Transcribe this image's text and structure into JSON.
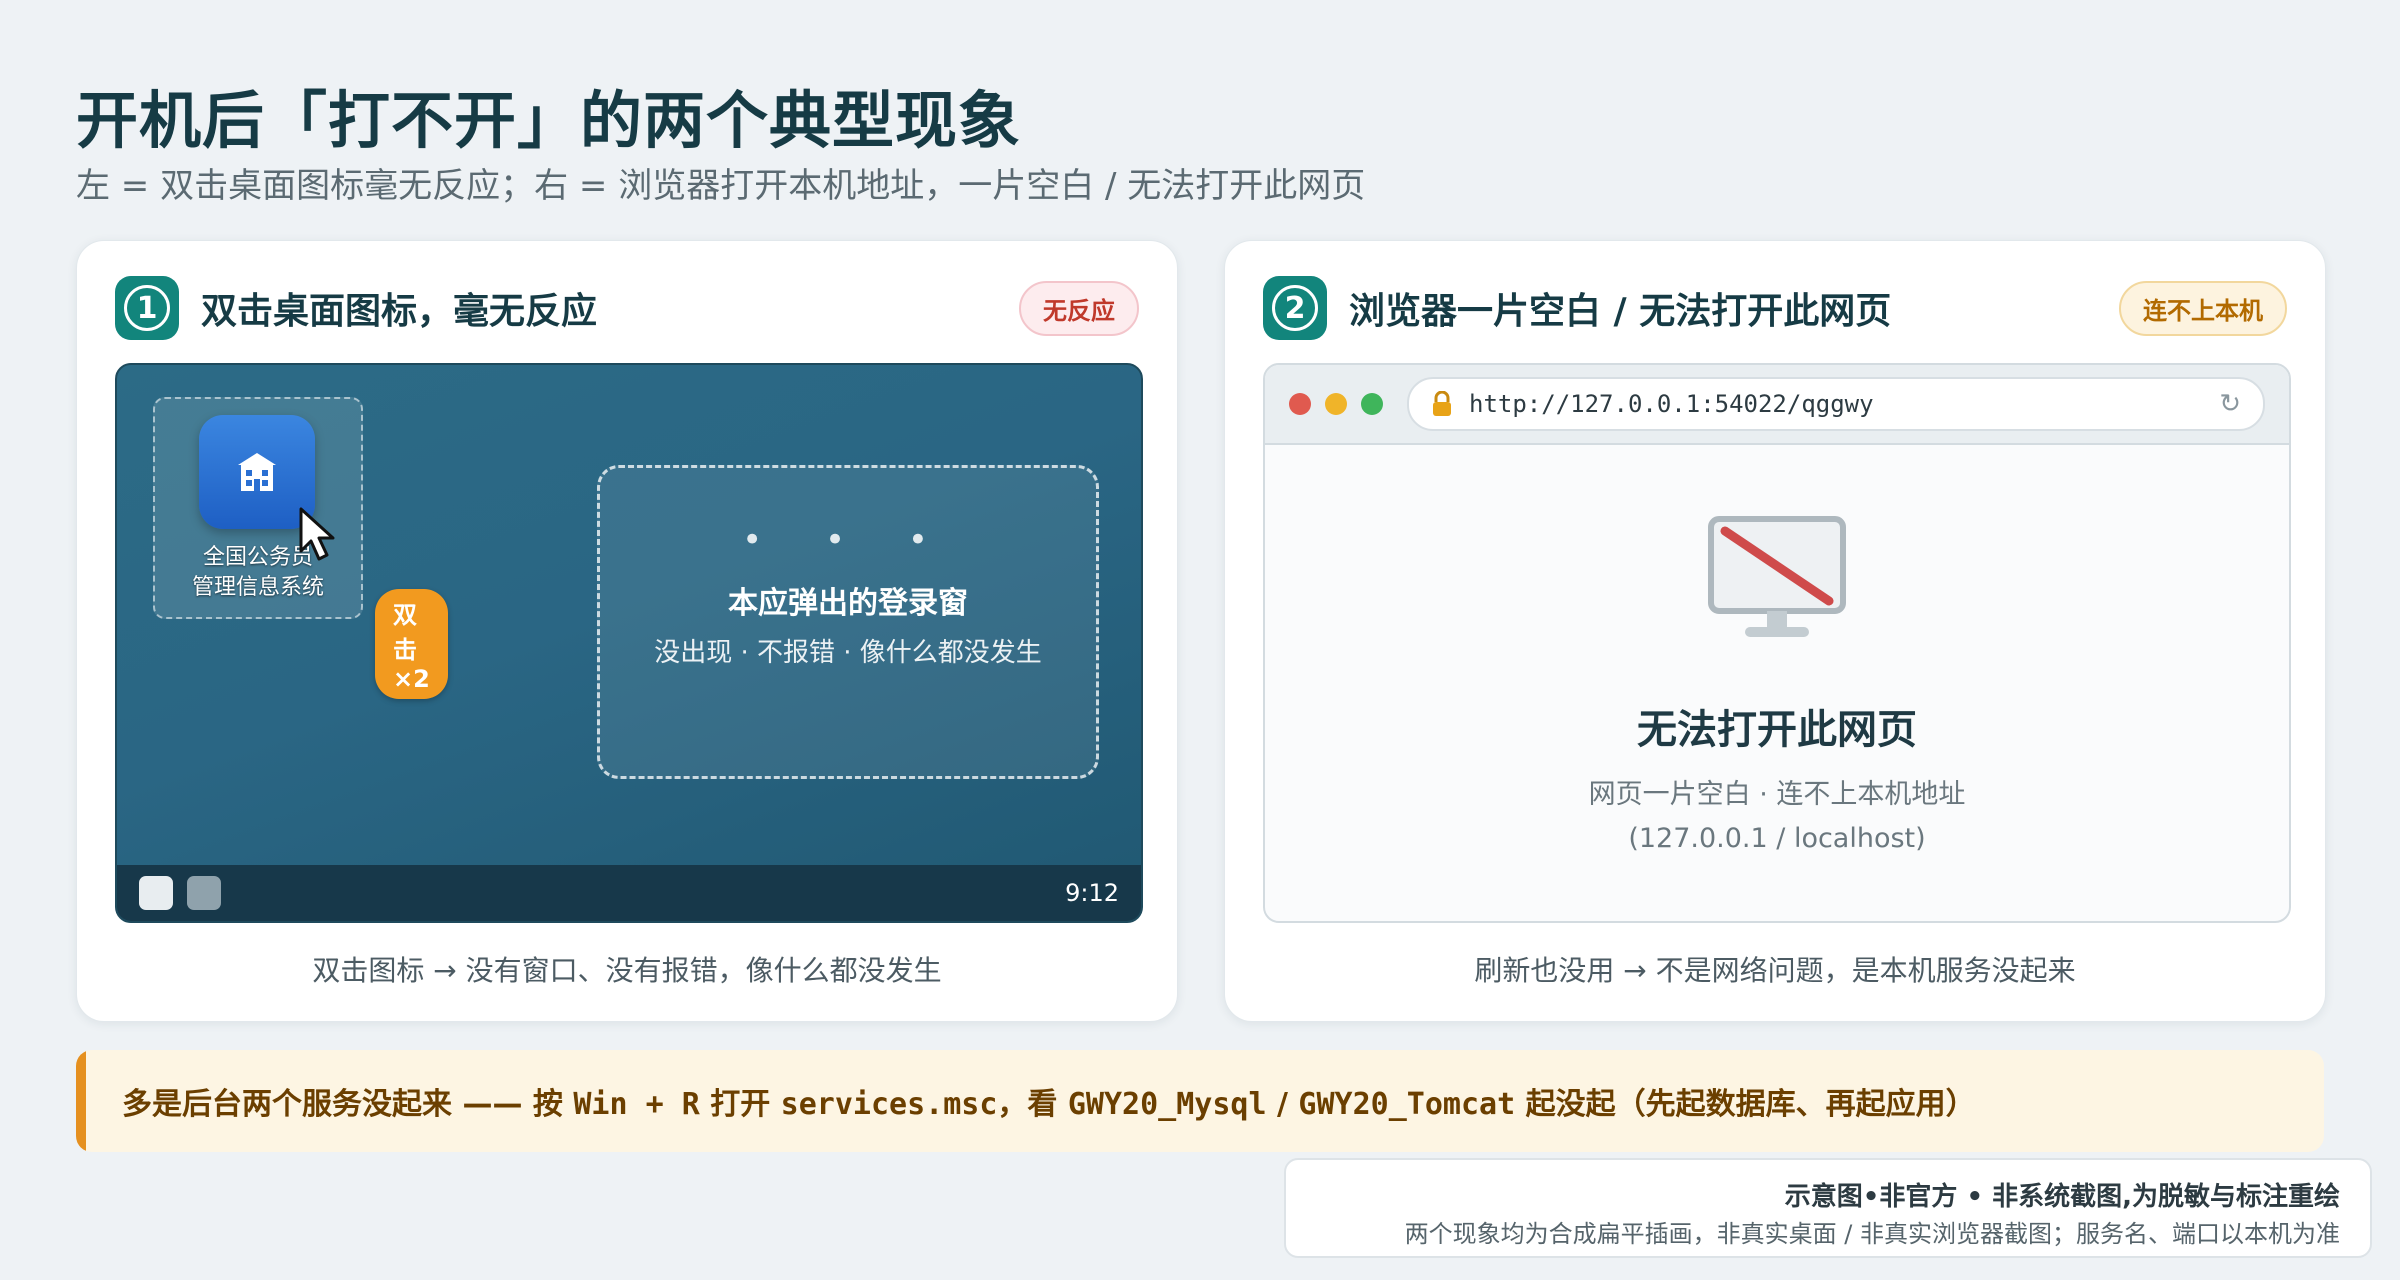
{
  "header": {
    "title": "开机后「打不开」的两个典型现象",
    "subtitle": "左 = 双击桌面图标毫无反应；右 = 浏览器打开本机地址，一片空白 / 无法打开此网页"
  },
  "left_card": {
    "number": "1",
    "title": "双击桌面图标，毫无反应",
    "badge": "无反应",
    "icon_label_line1": "全国公务员",
    "icon_label_line2": "管理信息系统",
    "click_pill": "双击 ×2",
    "ghost_dots": "• • •",
    "ghost_title": "本应弹出的登录窗",
    "ghost_sub": "没出现 · 不报错 · 像什么都没发生",
    "clock": "9:12",
    "caption": "双击图标 → 没有窗口、没有报错，像什么都没发生"
  },
  "right_card": {
    "number": "2",
    "title": "浏览器一片空白 / 无法打开此网页",
    "badge": "连不上本机",
    "url": "http://127.0.0.1:54022/qggwy",
    "error_title": "无法打开此网页",
    "error_sub1": "网页一片空白 · 连不上本机地址",
    "error_sub2": "(127.0.0.1 / localhost)",
    "caption": "刷新也没用 → 不是网络问题，是本机服务没起来"
  },
  "banner": {
    "p1": "多是后台两个服务没起来 —— 按 ",
    "k1": "Win + R",
    "p2": " 打开 ",
    "k2": "services.msc",
    "p3": "，看 ",
    "k3": "GWY20_Mysql",
    "p4": " / ",
    "k4": "GWY20_Tomcat",
    "p5": " 起没起（先起数据库、再起应用）"
  },
  "note": {
    "line1": "示意图•非官方 • 非系统截图,为脱敏与标注重绘",
    "line2": "两个现象均为合成扁平插画，非真实桌面 / 非真实浏览器截图；服务名、端口以本机为准"
  },
  "colors": {
    "accent": "#12857c",
    "warning": "#e5901f",
    "error": "#c0392b"
  }
}
